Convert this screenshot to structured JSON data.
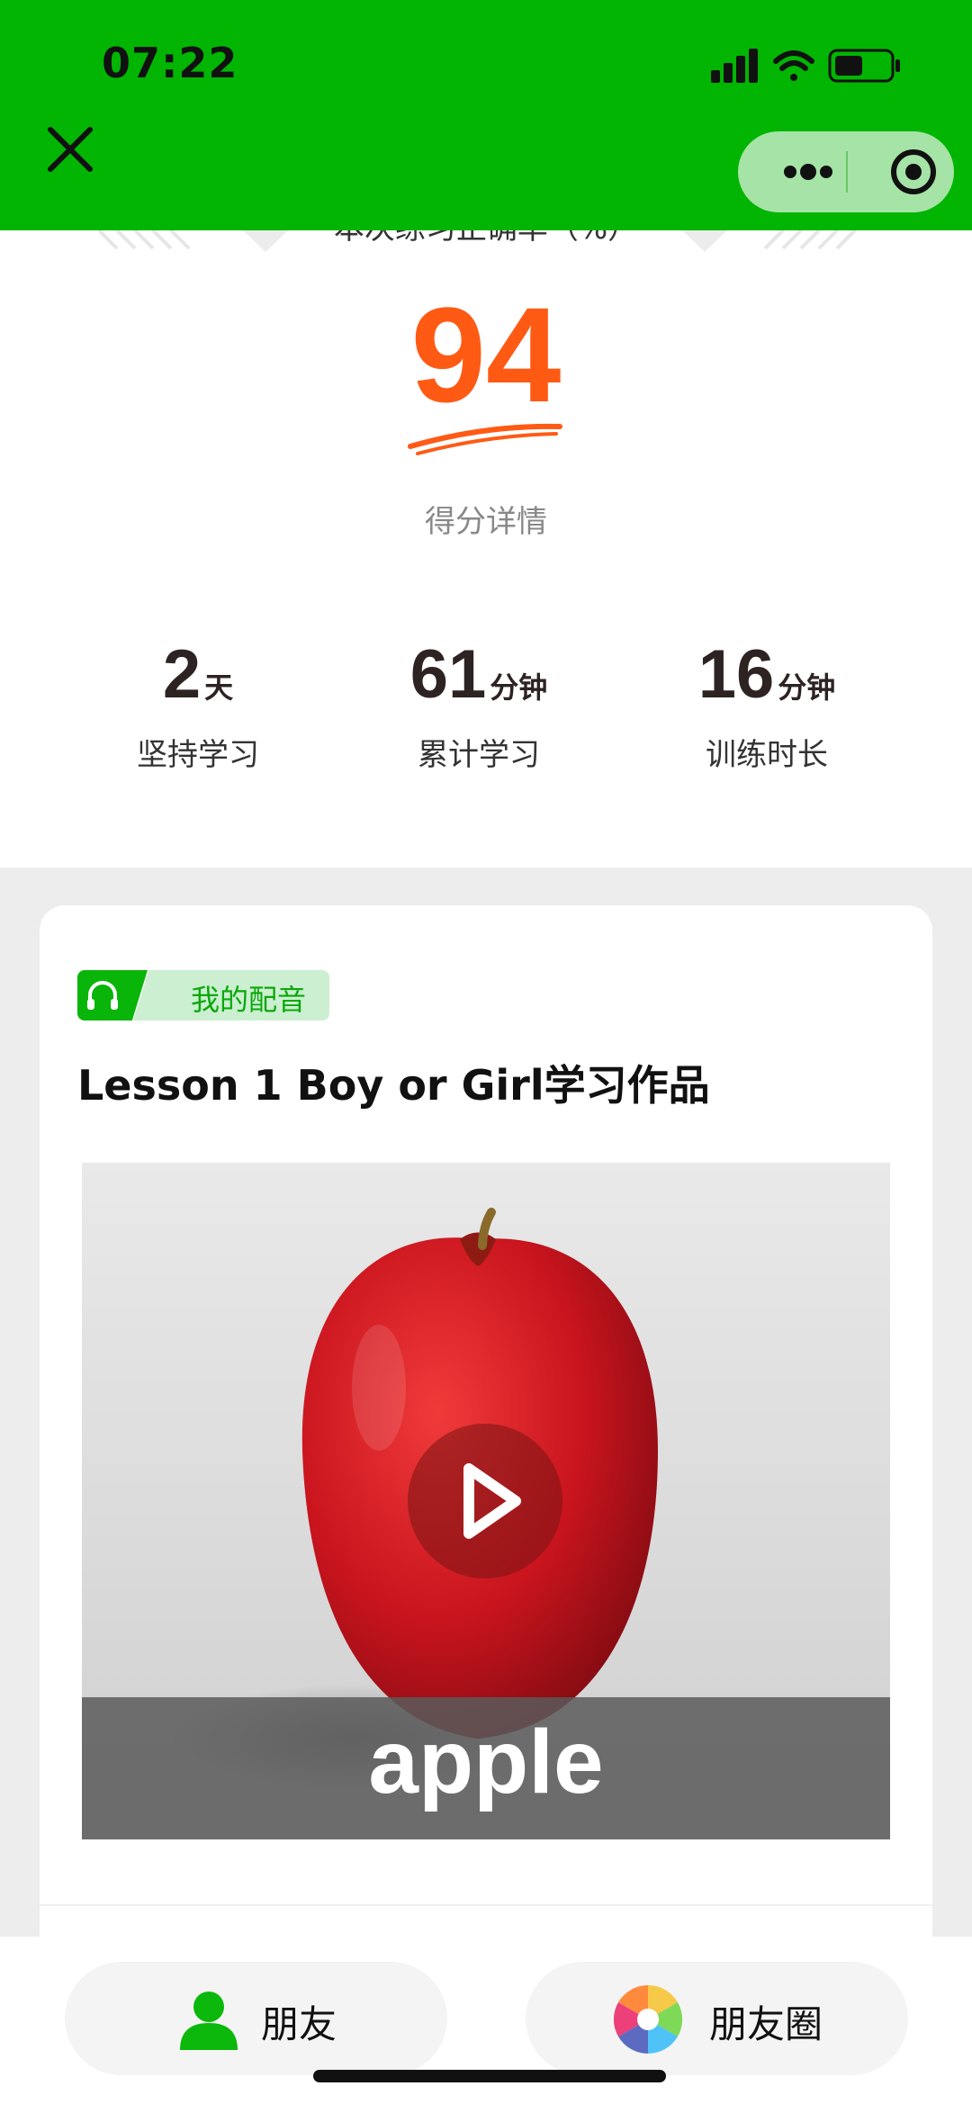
{
  "status_bar": {
    "time": "07:22"
  },
  "header": {
    "close_icon": "close-icon",
    "more_icon": "more-dots-icon",
    "exit_icon": "target-circle-icon",
    "bg_color": "#02b502"
  },
  "score": {
    "title": "本次练习正确率（%）",
    "value": "94",
    "detail_link": "得分详情",
    "color": "#ff5a14"
  },
  "stats": [
    {
      "value": "2",
      "unit": "天",
      "label": "坚持学习"
    },
    {
      "value": "61",
      "unit": "分钟",
      "label": "累计学习"
    },
    {
      "value": "16",
      "unit": "分钟",
      "label": "训练时长"
    }
  ],
  "card": {
    "badge": "我的配音",
    "title": "Lesson 1 Boy or Girl学习作品",
    "media_caption": "apple",
    "media_icon": "play-icon"
  },
  "share": {
    "friends": "朋友",
    "moments": "朋友圈"
  }
}
